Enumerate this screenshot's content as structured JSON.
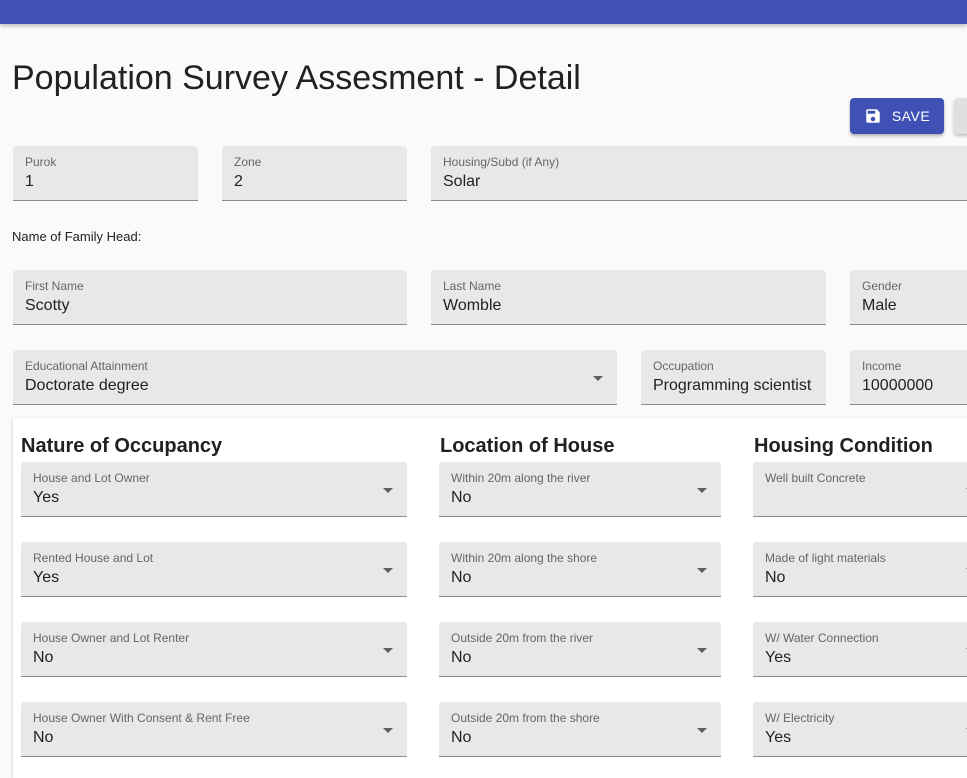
{
  "header": {
    "title": "Population Survey Assesment - Detail"
  },
  "actions": {
    "save_label": "SAVE"
  },
  "location": {
    "purok": {
      "label": "Purok",
      "value": "1"
    },
    "zone": {
      "label": "Zone",
      "value": "2"
    },
    "housing": {
      "label": "Housing/Subd (if Any)",
      "value": "Solar"
    }
  },
  "family_head": {
    "section_label": "Name of Family Head:",
    "first_name": {
      "label": "First Name",
      "value": "Scotty"
    },
    "last_name": {
      "label": "Last Name",
      "value": "Womble"
    },
    "gender": {
      "label": "Gender",
      "value": "Male"
    },
    "education": {
      "label": "Educational Attainment",
      "value": "Doctorate degree"
    },
    "occupation": {
      "label": "Occupation",
      "value": "Programming scientist"
    },
    "income": {
      "label": "Income",
      "value": "10000000"
    }
  },
  "occupancy": {
    "title": "Nature of Occupancy",
    "fields": [
      {
        "label": "House and Lot Owner",
        "value": "Yes"
      },
      {
        "label": "Rented House and Lot",
        "value": "Yes"
      },
      {
        "label": "House Owner and Lot Renter",
        "value": "No"
      },
      {
        "label": "House Owner With Consent & Rent Free",
        "value": "No"
      }
    ]
  },
  "house_location": {
    "title": "Location of House",
    "fields": [
      {
        "label": "Within 20m along the river",
        "value": "No"
      },
      {
        "label": "Within 20m along the shore",
        "value": "No"
      },
      {
        "label": "Outside 20m from the river",
        "value": "No"
      },
      {
        "label": "Outside 20m from the shore",
        "value": "No"
      }
    ]
  },
  "housing_condition": {
    "title": "Housing Condition",
    "fields": [
      {
        "label": "Well built Concrete",
        "value": ""
      },
      {
        "label": "Made of light materials",
        "value": "No"
      },
      {
        "label": "W/ Water Connection",
        "value": "Yes"
      },
      {
        "label": "W/ Electricity",
        "value": "Yes"
      }
    ]
  },
  "colors": {
    "primary": "#3f51b5",
    "field_bg": "#e8e8e8",
    "page_bg": "#fafafa"
  },
  "icons": {
    "save": "save-icon",
    "dropdown": "arrow-drop-down-icon"
  }
}
